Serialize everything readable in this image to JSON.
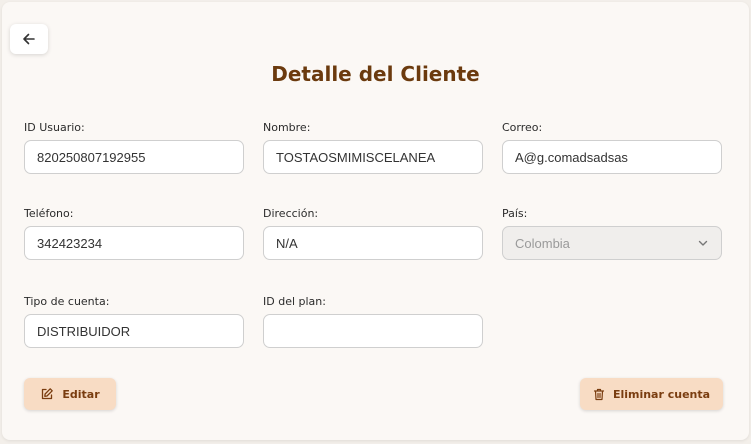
{
  "header": {
    "back_icon": "arrow-left-icon",
    "title": "Detalle del Cliente"
  },
  "fields": {
    "id_usuario": {
      "label": "ID Usuario:",
      "value": "820250807192955"
    },
    "nombre": {
      "label": "Nombre:",
      "value": "TOSTAOSMIMISCELANEA"
    },
    "correo": {
      "label": "Correo:",
      "value": "A@g.comadsadsas"
    },
    "telefono": {
      "label": "Teléfono:",
      "value": "342423234"
    },
    "direccion": {
      "label": "Dirección:",
      "value": "N/A"
    },
    "pais": {
      "label": "País:",
      "value": "Colombia",
      "disabled": true
    },
    "tipo_cuenta": {
      "label": "Tipo de cuenta:",
      "value": "DISTRIBUIDOR"
    },
    "id_plan": {
      "label": "ID del plan:",
      "value": ""
    }
  },
  "actions": {
    "edit_label": "Editar",
    "edit_icon": "edit-icon",
    "delete_label": "Eliminar cuenta",
    "delete_icon": "trash-icon"
  },
  "colors": {
    "title": "#6b3a0e",
    "button_bg": "#f8dcc4",
    "button_text": "#7a3d10"
  }
}
